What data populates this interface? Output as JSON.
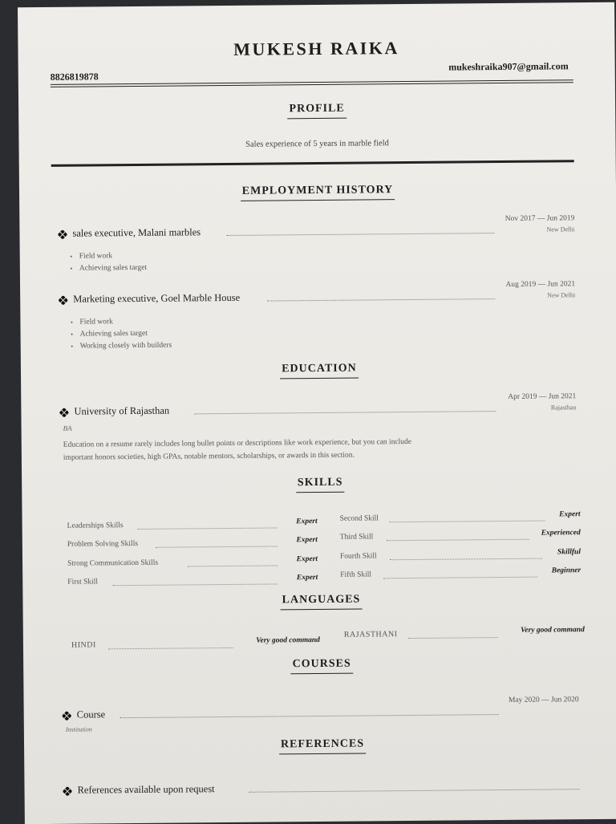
{
  "header": {
    "name": "MUKESH RAIKA",
    "phone": "8826819878",
    "email": "mukeshraika907@gmail.com"
  },
  "profile": {
    "heading": "PROFILE",
    "text": "Sales experience of 5 years in marble field"
  },
  "employment": {
    "heading": "EMPLOYMENT HISTORY",
    "jobs": [
      {
        "title": "sales executive, Malani marbles",
        "dates": "Nov 2017 — Jun 2019",
        "location": "New Delhi",
        "bullets": [
          "Field work",
          "Achieving sales target"
        ]
      },
      {
        "title": "Marketing executive, Goel Marble House",
        "dates": "Aug 2019 — Jun 2021",
        "location": "New Delhi",
        "bullets": [
          "Field work",
          "Achieving sales target",
          "Working closely with builders"
        ]
      }
    ]
  },
  "education": {
    "heading": "EDUCATION",
    "school": "University of Rajasthan",
    "degree": "BA",
    "dates": "Apr 2019 — Jun 2021",
    "location": "Rajasthan",
    "description_line1": "Education on a resume rarely includes long bullet points or descriptions like work experience, but you can include",
    "description_line2": "important honors societies, high GPAs, notable mentors, scholarships, or awards in this section."
  },
  "skills": {
    "heading": "SKILLS",
    "left": [
      {
        "name": "Leaderships Skills",
        "level": "Expert"
      },
      {
        "name": "Problem Solving Skills",
        "level": "Expert"
      },
      {
        "name": "Strong Communication Skills",
        "level": "Expert"
      },
      {
        "name": "First Skill",
        "level": "Expert"
      }
    ],
    "right": [
      {
        "name": "Second Skill",
        "level": "Expert"
      },
      {
        "name": "Third Skill",
        "level": "Experienced"
      },
      {
        "name": "Fourth Skill",
        "level": "Skillful"
      },
      {
        "name": "Fifth Skill",
        "level": "Beginner"
      }
    ]
  },
  "languages": {
    "heading": "LANGUAGES",
    "items": [
      {
        "name": "HINDI",
        "level": "Very good command"
      },
      {
        "name": "RAJASTHANI",
        "level": "Very good command"
      }
    ]
  },
  "courses": {
    "heading": "COURSES",
    "title": "Course",
    "institution": "Institution",
    "dates": "May 2020 — Jun 2020"
  },
  "references": {
    "heading": "REFERENCES",
    "text": "References available upon request"
  },
  "colors": {
    "background": "#2b2c30",
    "paper": "#ebe9e4",
    "ink": "#1e1e1e"
  }
}
